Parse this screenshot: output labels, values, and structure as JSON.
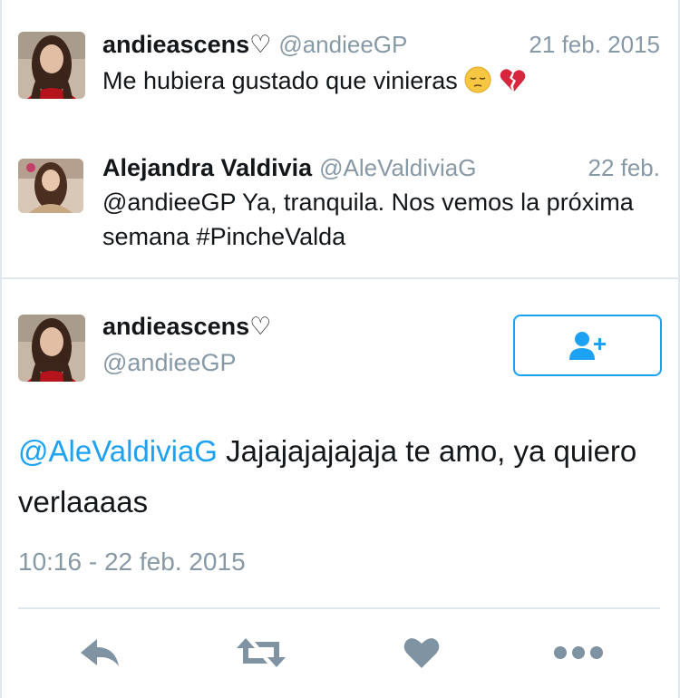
{
  "tweets": [
    {
      "name": "andieascens♡",
      "handle": "@andieeGP",
      "time": "21 feb. 2015",
      "text": "Me hubiera gustado que vinieras",
      "emojis": [
        "pensive-face",
        "broken-heart"
      ]
    },
    {
      "name": "Alejandra Valdivia",
      "handle": "@AleValdiviaG",
      "time": "22 feb.",
      "text": "@andieeGP Ya, tranquila. Nos vemos la próxima semana #PincheValda"
    }
  ],
  "main_tweet": {
    "name": "andieascens♡",
    "handle": "@andieeGP",
    "mention": "@AleValdiviaG",
    "text": " Jajajajajajaja te amo, ya quiero verlaaaas",
    "timestamp": "10:16 - 22 feb. 2015",
    "follow_icon": "follow-person-plus-icon"
  },
  "actions": [
    {
      "name": "reply",
      "icon": "reply-icon"
    },
    {
      "name": "retweet",
      "icon": "retweet-icon"
    },
    {
      "name": "like",
      "icon": "heart-icon"
    },
    {
      "name": "more",
      "icon": "more-dots-icon"
    }
  ],
  "colors": {
    "accent": "#1da1f2",
    "muted": "#8899a6",
    "icon": "#7f93a3",
    "divider": "#e1e8ed",
    "text": "#14171a"
  }
}
